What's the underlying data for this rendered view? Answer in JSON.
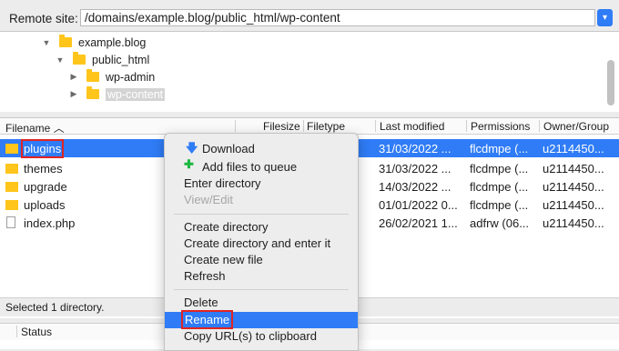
{
  "remote": {
    "label": "Remote site:",
    "path": "/domains/example.blog/public_html/wp-content"
  },
  "tree": [
    {
      "label": "example.blog",
      "expanded": true,
      "indent": 0
    },
    {
      "label": "public_html",
      "expanded": true,
      "indent": 1
    },
    {
      "label": "wp-admin",
      "expanded": false,
      "indent": 2
    },
    {
      "label": "wp-content",
      "expanded": false,
      "indent": 2,
      "selected": true
    }
  ],
  "columns": {
    "filename": "Filename",
    "filesize": "Filesize",
    "filetype": "Filetype",
    "last_modified": "Last modified",
    "permissions": "Permissions",
    "owner": "Owner/Group"
  },
  "files": [
    {
      "name": "plugins",
      "type": "folder",
      "modified": "31/03/2022 ...",
      "perms": "flcdmpe (...",
      "owner": "u2114450...",
      "selected": true
    },
    {
      "name": "themes",
      "type": "folder",
      "modified": "31/03/2022 ...",
      "perms": "flcdmpe (...",
      "owner": "u2114450..."
    },
    {
      "name": "upgrade",
      "type": "folder",
      "modified": "14/03/2022 ...",
      "perms": "flcdmpe (...",
      "owner": "u2114450..."
    },
    {
      "name": "uploads",
      "type": "folder",
      "modified": "01/01/2022 0...",
      "perms": "flcdmpe (...",
      "owner": "u2114450..."
    },
    {
      "name": "index.php",
      "type": "file",
      "modified": "26/02/2021 1...",
      "perms": "adfrw (06...",
      "owner": "u2114450..."
    }
  ],
  "status_line": "Selected 1 directory.",
  "queue_header": {
    "status": "Status"
  },
  "context_menu": {
    "download": "Download",
    "add_to_queue": "Add files to queue",
    "enter_directory": "Enter directory",
    "view_edit": "View/Edit",
    "create_directory": "Create directory",
    "create_dir_enter": "Create directory and enter it",
    "create_file": "Create new file",
    "refresh": "Refresh",
    "delete": "Delete",
    "rename": "Rename",
    "copy_url": "Copy URL(s) to clipboard"
  },
  "colors": {
    "accent": "#2f7cf6",
    "folder": "#ffc51a",
    "highlight_box": "#e02424"
  }
}
